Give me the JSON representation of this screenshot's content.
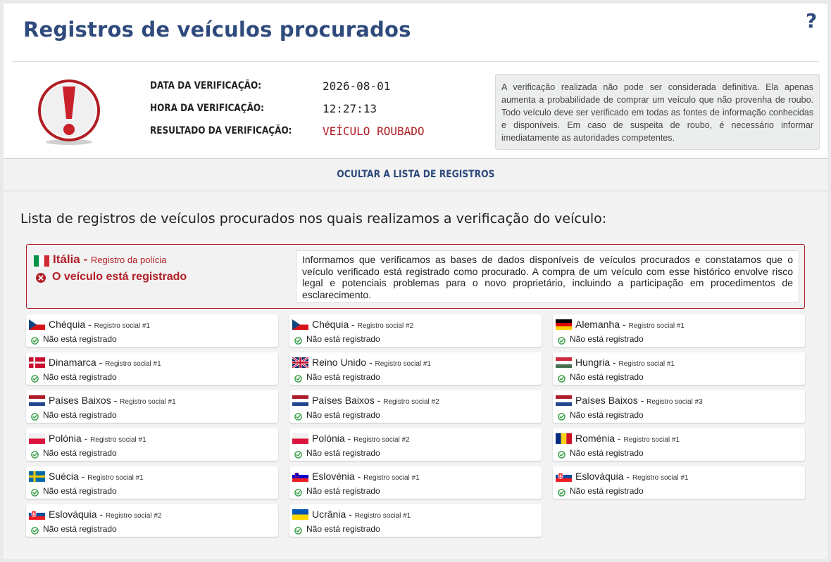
{
  "header": {
    "title": "Registros de veículos procurados",
    "help_glyph": "?"
  },
  "check": {
    "date_label": "DATA DA VERIFICAÇÃO:",
    "date_value": "2026-08-01",
    "time_label": "HORA DA VERIFICAÇÃO:",
    "time_value": "12:27:13",
    "result_label": "RESULTADO DA VERIFICAÇÃO:",
    "result_value": "VEÍCULO ROUBADO",
    "alert_icon": "exclamation-alert-icon"
  },
  "disclaimer": "A verificação realizada não pode ser considerada definitiva. Ela apenas aumenta a probabilidade de comprar um veículo que não provenha de roubo. Todo veículo deve ser verificado em todas as fontes de informação conhecidas e disponíveis. Em caso de suspeita de roubo, é necessário informar imediatamente as autoridades competentes.",
  "toggle": {
    "label": "OCULTAR A LISTA DE REGISTROS"
  },
  "list": {
    "heading": "Lista de registros de veículos procurados nos quais realizamos a verificação do veículo:",
    "highlight": {
      "country": "Itália",
      "separator": " - ",
      "register": "Registro da polícia",
      "status": "O veículo está registrado",
      "message": "Informamos que verificamos as bases de dados disponíveis de veículos procurados e constatamos que o veículo verificado está registrado como procurado. A compra de um veículo com esse histórico envolve risco legal e potenciais problemas para o novo proprietário, incluindo a participação em procedimentos de esclarecimento.",
      "flag": "italy-flag",
      "color": "#b11d24"
    },
    "registries": [
      {
        "country": "Chéquia",
        "separator": " - ",
        "source": "Registro social #1",
        "status": "Não está registrado",
        "flag": "cz"
      },
      {
        "country": "Chéquia",
        "separator": " - ",
        "source": "Registro social #2",
        "status": "Não está registrado",
        "flag": "cz"
      },
      {
        "country": "Alemanha",
        "separator": " - ",
        "source": "Registro social #1",
        "status": "Não está registrado",
        "flag": "de"
      },
      {
        "country": "Dinamarca",
        "separator": " - ",
        "source": "Registro social #1",
        "status": "Não está registrado",
        "flag": "dk"
      },
      {
        "country": "Reino Unido",
        "separator": " - ",
        "source": "Registro social #1",
        "status": "Não está registrado",
        "flag": "gb"
      },
      {
        "country": "Hungria",
        "separator": " - ",
        "source": "Registro social #1",
        "status": "Não está registrado",
        "flag": "hu"
      },
      {
        "country": "Países Baixos",
        "separator": " - ",
        "source": "Registro social #1",
        "status": "Não está registrado",
        "flag": "nl"
      },
      {
        "country": "Países Baixos",
        "separator": " - ",
        "source": "Registro social #2",
        "status": "Não está registrado",
        "flag": "nl"
      },
      {
        "country": "Países Baixos",
        "separator": " - ",
        "source": "Registro social #3",
        "status": "Não está registrado",
        "flag": "nl"
      },
      {
        "country": "Polónia",
        "separator": " - ",
        "source": "Registro social #1",
        "status": "Não está registrado",
        "flag": "pl"
      },
      {
        "country": "Polónia",
        "separator": " - ",
        "source": "Registro social #2",
        "status": "Não está registrado",
        "flag": "pl"
      },
      {
        "country": "Roménia",
        "separator": " - ",
        "source": "Registro social #1",
        "status": "Não está registrado",
        "flag": "ro"
      },
      {
        "country": "Suécia",
        "separator": " - ",
        "source": "Registro social #1",
        "status": "Não está registrado",
        "flag": "se"
      },
      {
        "country": "Eslovénia",
        "separator": " - ",
        "source": "Registro social #1",
        "status": "Não está registrado",
        "flag": "si"
      },
      {
        "country": "Eslováquia",
        "separator": " - ",
        "source": "Registro social #1",
        "status": "Não está registrado",
        "flag": "sk"
      },
      {
        "country": "Eslováquia",
        "separator": " - ",
        "source": "Registro social #2",
        "status": "Não está registrado",
        "flag": "sk"
      },
      {
        "country": "Ucrânia",
        "separator": " - ",
        "source": "Registro social #1",
        "status": "Não está registrado",
        "flag": "ua"
      }
    ]
  },
  "colors": {
    "title": "#2f4a7c",
    "alert": "#b11d24",
    "ok": "#2e9a3f",
    "card": "#ffffff",
    "panel": "#f3f3f3"
  }
}
